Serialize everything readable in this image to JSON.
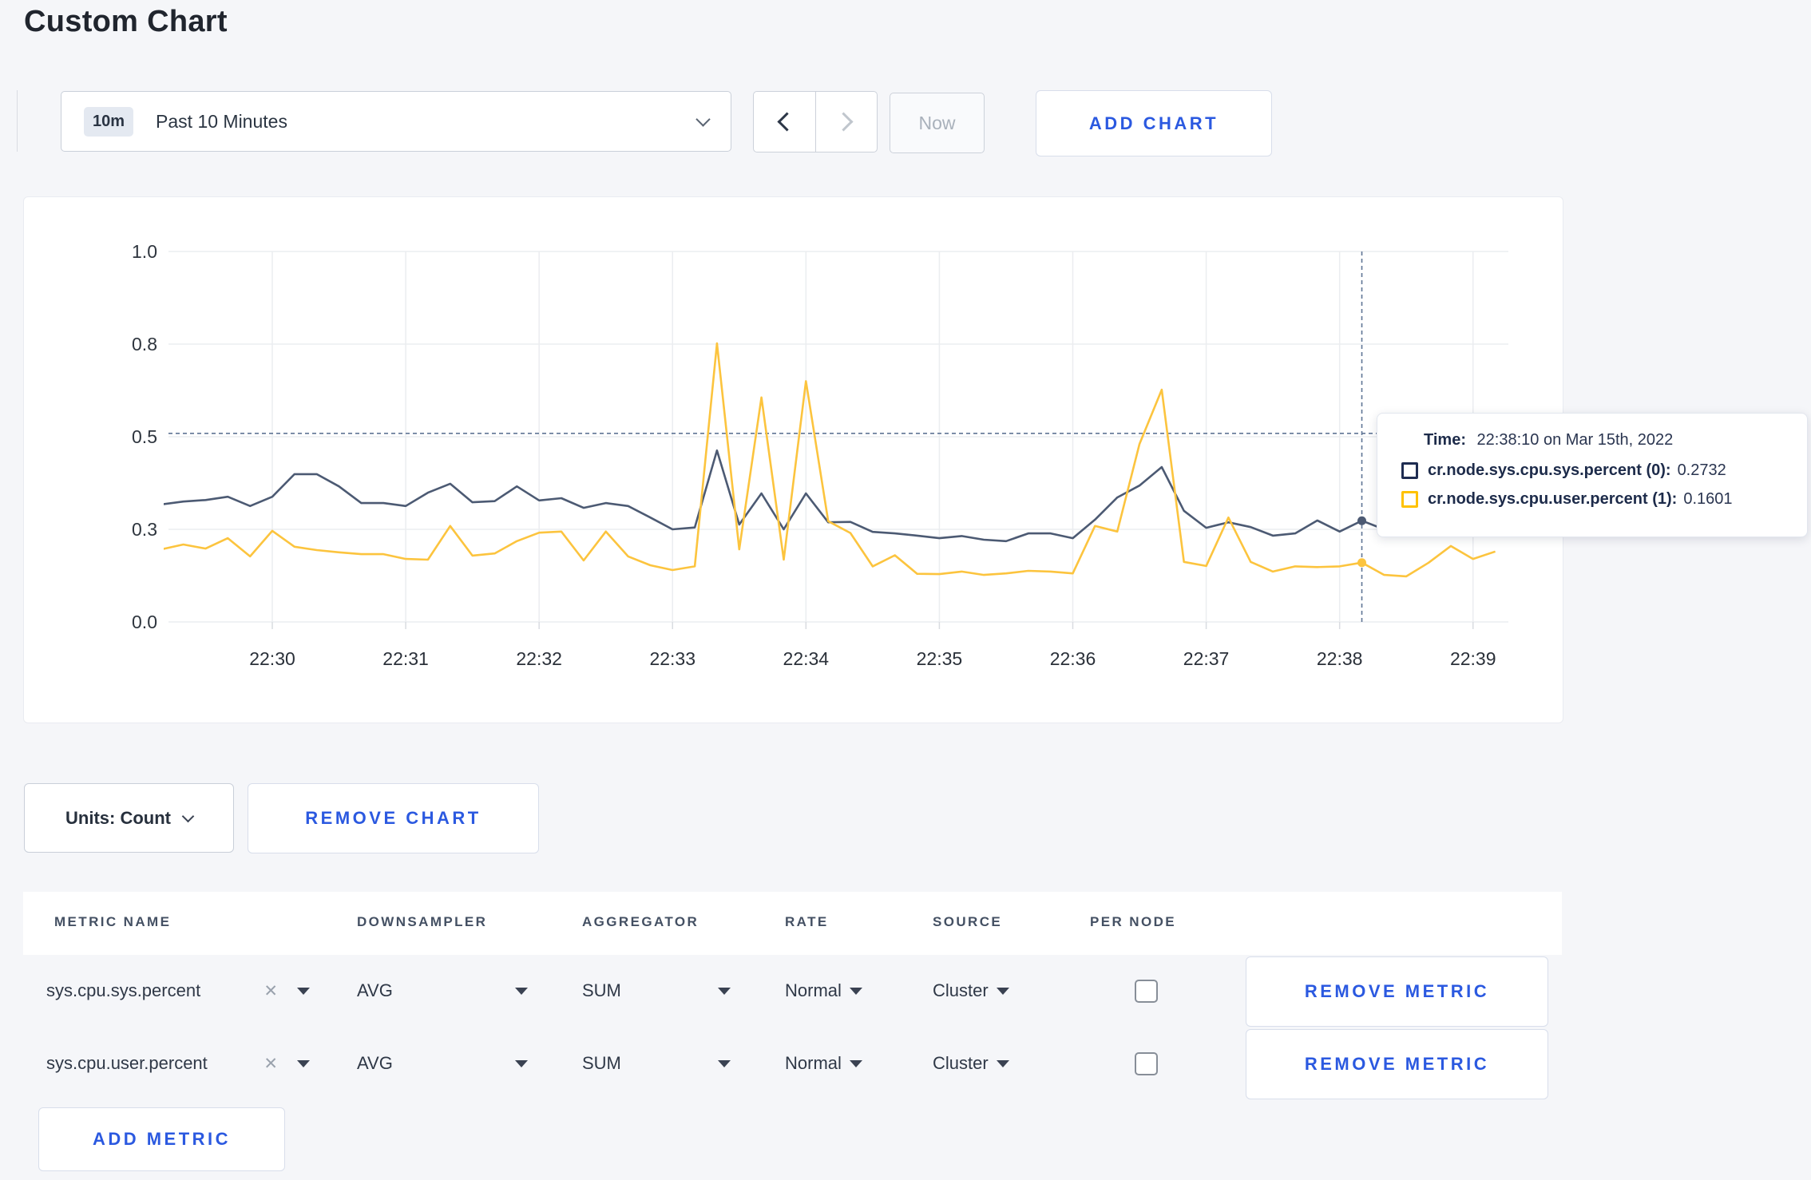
{
  "page": {
    "title": "Custom Chart"
  },
  "toolbar": {
    "time_range_badge": "10m",
    "time_range_label": "Past 10 Minutes",
    "now_label": "Now",
    "add_chart_label": "ADD CHART",
    "icons": {
      "dropdown": "chevron-down",
      "prev": "chevron-left",
      "next": "chevron-right"
    }
  },
  "chart": {
    "tooltip": {
      "time_label": "Time:",
      "time_value": "22:38:10 on Mar 15th, 2022",
      "rows": [
        {
          "label": "cr.node.sys.cpu.sys.percent (0):",
          "value": "0.2732",
          "swatch_color": "#1e2c51"
        },
        {
          "label": "cr.node.sys.cpu.user.percent (1):",
          "value": "0.1601",
          "swatch_color": "#ffc200"
        }
      ]
    }
  },
  "chart_data": {
    "type": "line",
    "title": "",
    "xlabel": "",
    "ylabel": "",
    "ylim": [
      0,
      1
    ],
    "grid": true,
    "y_ticks": [
      {
        "value": 0,
        "label": "0.0"
      },
      {
        "value": 0.25,
        "label": "0.3"
      },
      {
        "value": 0.5,
        "label": "0.5"
      },
      {
        "value": 0.75,
        "label": "0.8"
      },
      {
        "value": 1,
        "label": "1.0"
      }
    ],
    "x_ticks": [
      {
        "label": "22:30",
        "minute": 0
      },
      {
        "label": "22:31",
        "minute": 1
      },
      {
        "label": "22:32",
        "minute": 2
      },
      {
        "label": "22:33",
        "minute": 3
      },
      {
        "label": "22:34",
        "minute": 4
      },
      {
        "label": "22:35",
        "minute": 5
      },
      {
        "label": "22:36",
        "minute": 6
      },
      {
        "label": "22:37",
        "minute": 7
      },
      {
        "label": "22:38",
        "minute": 8
      },
      {
        "label": "22:39",
        "minute": 9
      }
    ],
    "x": [
      "22:29:10",
      "22:29:20",
      "22:29:30",
      "22:29:40",
      "22:29:50",
      "22:30:00",
      "22:30:10",
      "22:30:20",
      "22:30:30",
      "22:30:40",
      "22:30:50",
      "22:31:00",
      "22:31:10",
      "22:31:20",
      "22:31:30",
      "22:31:40",
      "22:31:50",
      "22:32:00",
      "22:32:10",
      "22:32:20",
      "22:32:30",
      "22:32:40",
      "22:32:50",
      "22:33:00",
      "22:33:10",
      "22:33:20",
      "22:33:30",
      "22:33:40",
      "22:33:50",
      "22:34:00",
      "22:34:10",
      "22:34:20",
      "22:34:30",
      "22:34:40",
      "22:34:50",
      "22:35:00",
      "22:35:10",
      "22:35:20",
      "22:35:30",
      "22:35:40",
      "22:35:50",
      "22:36:00",
      "22:36:10",
      "22:36:20",
      "22:36:30",
      "22:36:40",
      "22:36:50",
      "22:37:00",
      "22:37:10",
      "22:37:20",
      "22:37:30",
      "22:37:40",
      "22:37:50",
      "22:38:00",
      "22:38:10",
      "22:38:20",
      "22:38:30",
      "22:38:40",
      "22:38:50",
      "22:39:00",
      "22:39:10"
    ],
    "series": [
      {
        "name": "cr.node.sys.cpu.sys.percent",
        "color": "#4c5a73",
        "values": [
          0.317,
          0.325,
          0.329,
          0.338,
          0.313,
          0.338,
          0.399,
          0.399,
          0.366,
          0.321,
          0.321,
          0.313,
          0.349,
          0.373,
          0.323,
          0.326,
          0.366,
          0.328,
          0.334,
          0.308,
          0.321,
          0.313,
          0.282,
          0.25,
          0.255,
          0.463,
          0.263,
          0.347,
          0.25,
          0.347,
          0.269,
          0.27,
          0.243,
          0.239,
          0.233,
          0.226,
          0.232,
          0.222,
          0.218,
          0.239,
          0.239,
          0.226,
          0.276,
          0.336,
          0.368,
          0.418,
          0.3,
          0.254,
          0.269,
          0.256,
          0.233,
          0.239,
          0.274,
          0.244,
          0.2732,
          0.25,
          0.262,
          0.275,
          0.29,
          0.3,
          0.298
        ]
      },
      {
        "name": "cr.node.sys.cpu.user.percent",
        "color": "#fcc43e",
        "values": [
          0.196,
          0.209,
          0.198,
          0.226,
          0.177,
          0.246,
          0.203,
          0.194,
          0.188,
          0.183,
          0.183,
          0.17,
          0.168,
          0.259,
          0.179,
          0.185,
          0.218,
          0.241,
          0.244,
          0.166,
          0.244,
          0.177,
          0.153,
          0.14,
          0.15,
          0.752,
          0.196,
          0.606,
          0.168,
          0.65,
          0.272,
          0.24,
          0.15,
          0.18,
          0.13,
          0.129,
          0.136,
          0.127,
          0.131,
          0.138,
          0.136,
          0.131,
          0.259,
          0.244,
          0.48,
          0.627,
          0.162,
          0.151,
          0.282,
          0.162,
          0.136,
          0.15,
          0.148,
          0.15,
          0.1601,
          0.127,
          0.123,
          0.16,
          0.205,
          0.17,
          0.19
        ]
      }
    ],
    "legend_position": "tooltip",
    "crosshair": {
      "time": "22:38:10",
      "y_value": 0.509
    }
  },
  "chart_controls": {
    "units_label": "Units: Count",
    "remove_chart_label": "REMOVE CHART"
  },
  "metrics_table": {
    "headers": [
      "METRIC NAME",
      "DOWNSAMPLER",
      "AGGREGATOR",
      "RATE",
      "SOURCE",
      "PER NODE"
    ],
    "close_glyph": "✕",
    "rows": [
      {
        "metric": "sys.cpu.sys.percent",
        "downsampler": "AVG",
        "aggregator": "SUM",
        "rate": "Normal",
        "source": "Cluster",
        "per_node_checked": false,
        "remove_label": "REMOVE METRIC"
      },
      {
        "metric": "sys.cpu.user.percent",
        "downsampler": "AVG",
        "aggregator": "SUM",
        "rate": "Normal",
        "source": "Cluster",
        "per_node_checked": false,
        "remove_label": "REMOVE METRIC"
      }
    ],
    "add_metric_label": "ADD METRIC"
  }
}
